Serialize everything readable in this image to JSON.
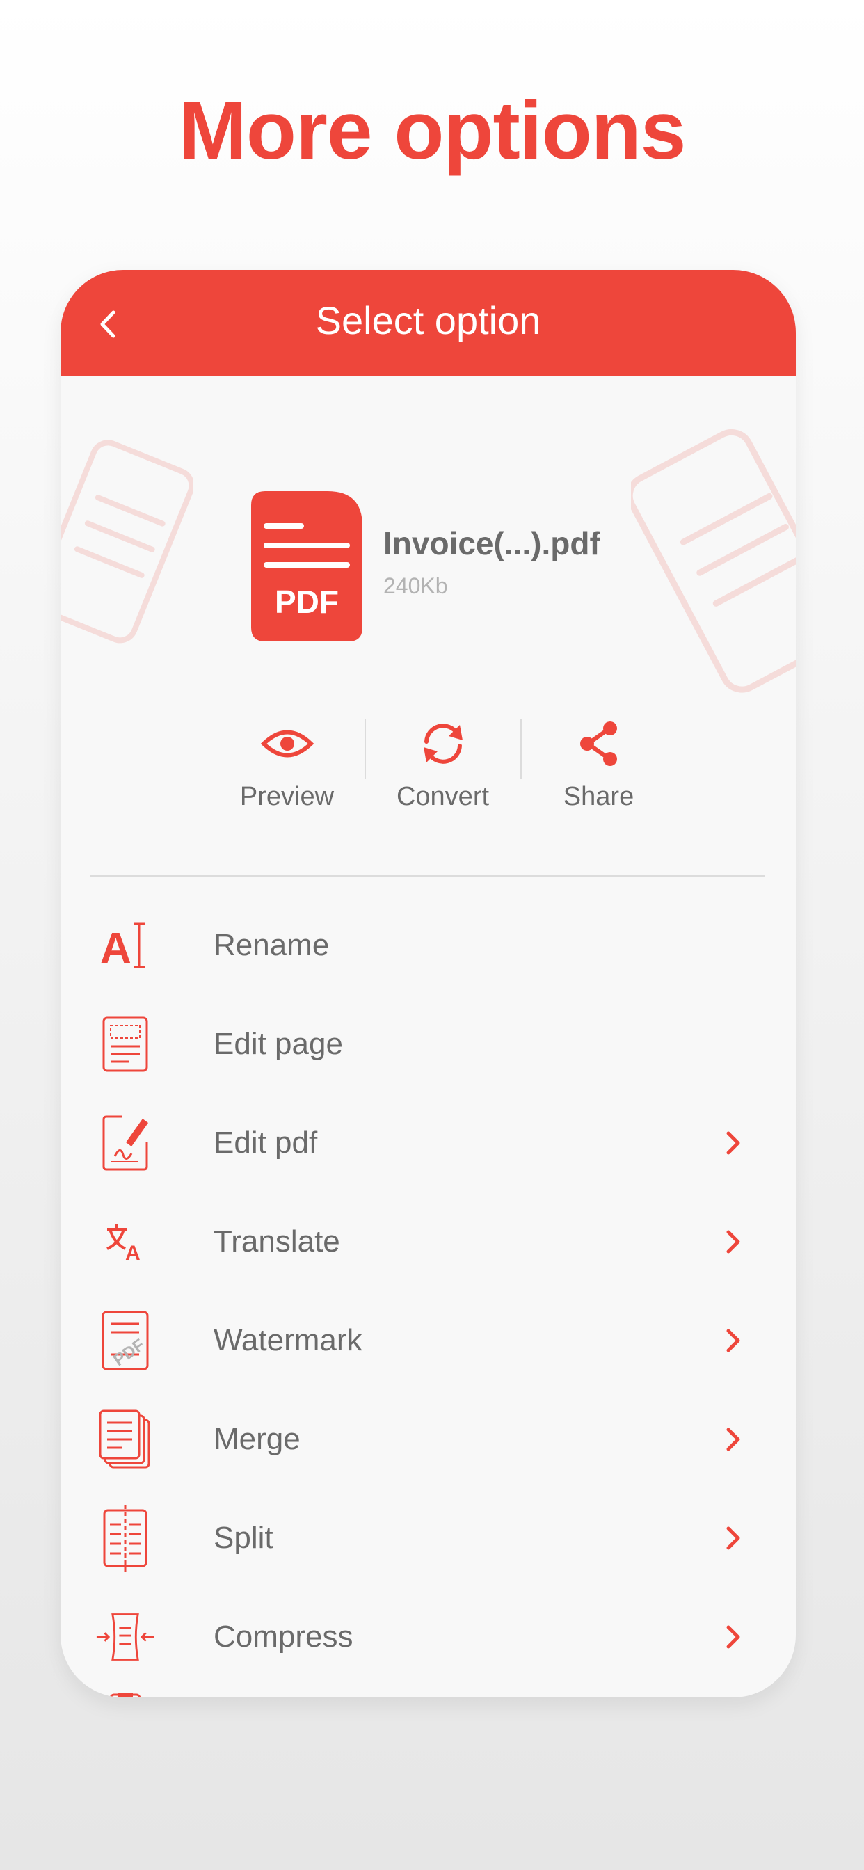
{
  "headline": "More options",
  "appbar": {
    "title": "Select option"
  },
  "file": {
    "icon_text": "PDF",
    "name": "Invoice(...).pdf",
    "size": "240Kb"
  },
  "actions": [
    {
      "label": "Preview",
      "icon": "eye-icon"
    },
    {
      "label": "Convert",
      "icon": "refresh-icon"
    },
    {
      "label": "Share",
      "icon": "share-icon"
    }
  ],
  "menu": [
    {
      "label": "Rename",
      "icon": "rename-icon",
      "has_chevron": false
    },
    {
      "label": "Edit page",
      "icon": "edit-page-icon",
      "has_chevron": false
    },
    {
      "label": "Edit pdf",
      "icon": "edit-pdf-icon",
      "has_chevron": true
    },
    {
      "label": "Translate",
      "icon": "translate-icon",
      "has_chevron": true
    },
    {
      "label": "Watermark",
      "icon": "watermark-icon",
      "has_chevron": true
    },
    {
      "label": "Merge",
      "icon": "merge-icon",
      "has_chevron": true
    },
    {
      "label": "Split",
      "icon": "split-icon",
      "has_chevron": true
    },
    {
      "label": "Compress",
      "icon": "compress-icon",
      "has_chevron": true
    }
  ],
  "colors": {
    "accent": "#ee463b",
    "text": "#6a6a6a",
    "muted": "#b3b3b3"
  }
}
